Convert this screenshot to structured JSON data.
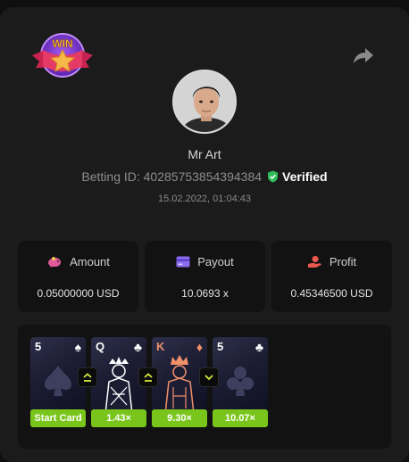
{
  "profile": {
    "name": "Mr Art",
    "betting_id_label": "Betting ID: 40285753854394384",
    "verified_label": "Verified",
    "datetime": "15.02.2022, 01:04:43"
  },
  "badge": {
    "text": "WIN"
  },
  "stats": [
    {
      "label": "Amount",
      "value": "0.05000000 USD",
      "icon": "piggy-bank-icon",
      "color": "#e05a9a"
    },
    {
      "label": "Payout",
      "value": "10.0693 x",
      "icon": "wallet-card-icon",
      "color": "#8b6cf0"
    },
    {
      "label": "Profit",
      "value": "0.45346500 USD",
      "icon": "hand-coin-icon",
      "color": "#e8584e"
    }
  ],
  "cards": [
    {
      "rank": "5",
      "suit": "♠",
      "suit_color": "#ffffff",
      "rank_color": "#ffffff",
      "chip": "Start Card"
    },
    {
      "rank": "Q",
      "suit": "♣",
      "suit_color": "#ffffff",
      "rank_color": "#ffffff",
      "chip": "1.43×"
    },
    {
      "rank": "K",
      "suit": "♦",
      "suit_color": "#f0906a",
      "rank_color": "#f0906a",
      "chip": "9.30×"
    },
    {
      "rank": "5",
      "suit": "♣",
      "suit_color": "#ffffff",
      "rank_color": "#ffffff",
      "chip": "10.07×"
    }
  ],
  "arrows": [
    {
      "direction": "higher-or-same",
      "icon": "chevron-up-double-icon"
    },
    {
      "direction": "higher-or-same",
      "icon": "chevron-up-double-icon"
    },
    {
      "direction": "lower",
      "icon": "chevron-down-icon"
    }
  ],
  "colors": {
    "accent_green": "#7ac51c",
    "verified_green": "#2ebd59",
    "arrow_yellow": "#d7e83a"
  }
}
